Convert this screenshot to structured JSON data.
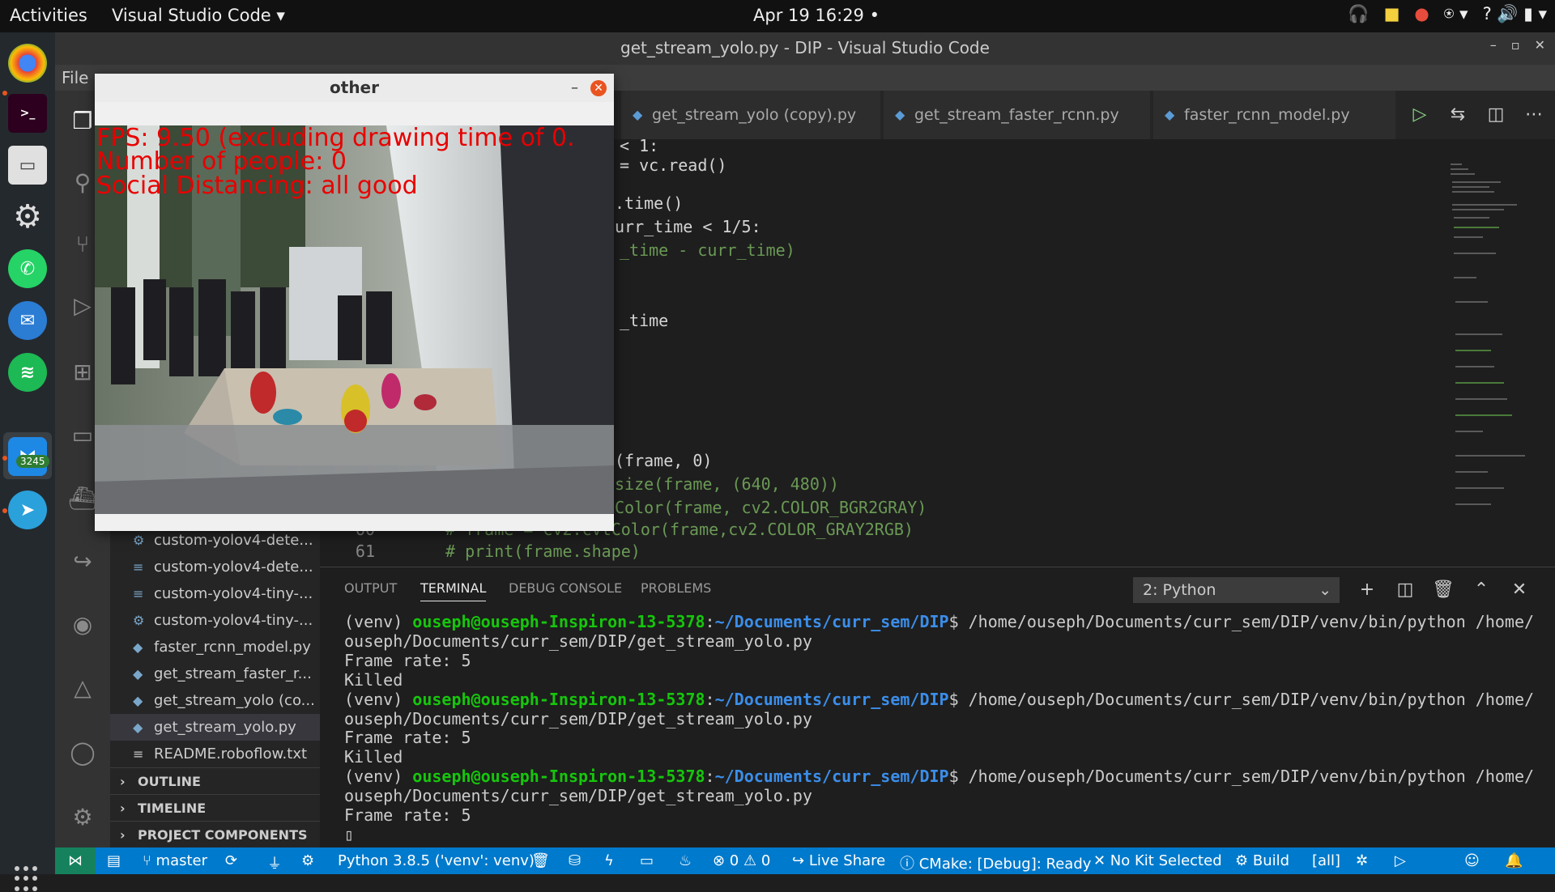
{
  "topbar": {
    "activities": "Activities",
    "app": "Visual Studio Code ▾",
    "clock": "Apr 19  16:29  •",
    "tray": [
      "🎧",
      "■",
      "●",
      "⍟ ▾",
      "? 🔊 ▮ ▾"
    ]
  },
  "dock": {
    "telegram_badge": "3245"
  },
  "window": {
    "title": "get_stream_yolo.py - DIP - Visual Studio Code",
    "controls": [
      "–",
      "▫",
      "✕"
    ]
  },
  "menu": {
    "file": "File"
  },
  "tabs": [
    {
      "label": "get_stream_yolo (copy).py"
    },
    {
      "label": "get_stream_faster_rcnn.py"
    },
    {
      "label": "faster_rcnn_model.py"
    }
  ],
  "editor": {
    "lines": [
      {
        "text": "< 1:",
        "comment": false
      },
      {
        "text": "= vc.read()",
        "comment": false
      },
      {
        "text": "",
        "comment": false
      },
      {
        "text": ".time()",
        "comment": false
      },
      {
        "text": "urr_time < 1/5:",
        "comment": false
      },
      {
        "text": "_time - curr_time)",
        "comment": true
      },
      {
        "text": "",
        "comment": false
      },
      {
        "text": "",
        "comment": false
      },
      {
        "text": "_time",
        "comment": false
      },
      {
        "text": "",
        "comment": false
      },
      {
        "text": "",
        "comment": false
      },
      {
        "text": "",
        "comment": false
      },
      {
        "text": "",
        "comment": false
      },
      {
        "text": "(frame, 0)",
        "comment": false
      },
      {
        "text": "size(frame, (640, 480))",
        "comment": true
      },
      {
        "text": "Color(frame, cv2.COLOR_BGR2GRAY)",
        "comment": true
      }
    ],
    "line60": {
      "num": "60",
      "text": "# frame = cv2.cvtColor(frame,cv2.COLOR_GRAY2RGB)"
    },
    "line61": {
      "num": "61",
      "text": "# print(frame.shape)"
    }
  },
  "sidebar": {
    "files": [
      "custom-yolov4-dete...",
      "custom-yolov4-dete...",
      "custom-yolov4-tiny-...",
      "custom-yolov4-tiny-...",
      "faster_rcnn_model.py",
      "get_stream_faster_r...",
      "get_stream_yolo (co...",
      "get_stream_yolo.py",
      "README.roboflow.txt"
    ],
    "sections": [
      "OUTLINE",
      "TIMELINE",
      "PROJECT COMPONENTS"
    ]
  },
  "panel": {
    "tabs": [
      "OUTPUT",
      "TERMINAL",
      "DEBUG CONSOLE",
      "PROBLEMS"
    ],
    "terminal_select": "2: Python",
    "prompt": {
      "venv": "(venv) ",
      "user": "ouseph@ouseph-Inspiron-13-5378",
      "colon": ":",
      "path": "~/Documents/curr_sem/DIP",
      "cmd": "$ /home/ouseph/Documents/curr_sem/DIP/venv/bin/python /home/"
    },
    "cont": "ouseph/Documents/curr_sem/DIP/get_stream_yolo.py",
    "frame_rate": "Frame rate: 5",
    "killed": "Killed",
    "cursor": "▯"
  },
  "status": {
    "branch": "master",
    "python": "Python 3.8.5 ('venv': venv)",
    "errors": "⊗ 0 ⚠ 0",
    "liveshare": "Live Share",
    "cmake": "ⓘ CMake: [Debug]: Ready",
    "kit": "✕ No Kit Selected",
    "build": "⚙ Build",
    "all": "[all]"
  },
  "cv": {
    "title": "other",
    "min": "–",
    "close": "✕",
    "fps": "FPS: 9.50 (excluding drawing time of 0.",
    "people": "Number of people: 0",
    "social": "Social Distancing: all good"
  }
}
